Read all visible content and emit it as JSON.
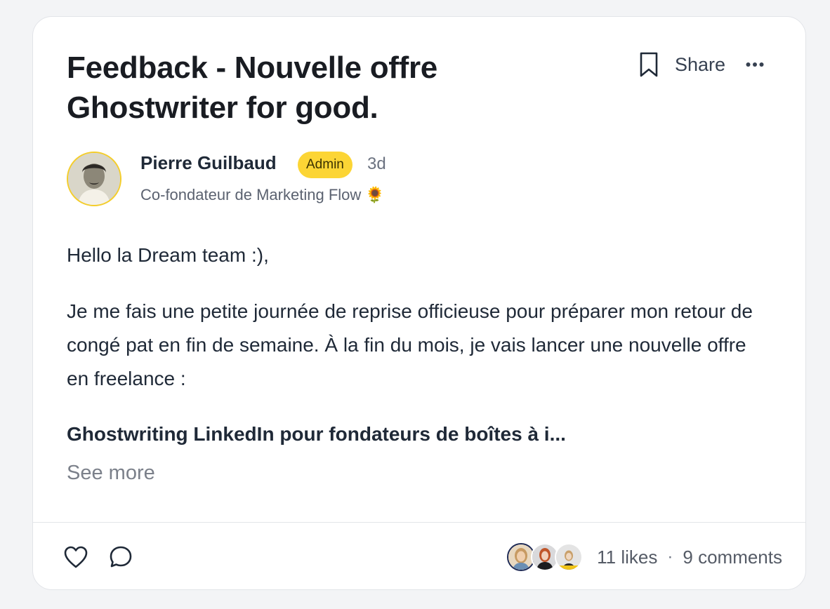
{
  "post": {
    "title": "Feedback - Nouvelle offre Ghostwriter for good.",
    "actions": {
      "share_label": "Share"
    },
    "author": {
      "name": "Pierre Guilbaud",
      "badge": "Admin",
      "time": "3d",
      "subtitle": "Co-fondateur de Marketing Flow 🌻"
    },
    "body": {
      "greeting": "Hello la Dream team :),",
      "paragraph": "Je me fais une petite journée de reprise officieuse pour préparer mon retour de congé pat en fin de semaine. À la fin du mois, je vais lancer une nouvelle offre en freelance :",
      "highlight": "Ghostwriting LinkedIn pour fondateurs de boîtes à i..."
    },
    "see_more_label": "See more",
    "footer": {
      "likes_label": "11 likes",
      "separator": "·",
      "comments_label": "9 comments"
    },
    "colors": {
      "badge_bg": "#fcd535",
      "avatar_ring": "#f4cd2a",
      "divider": "#e3e5e8"
    },
    "icons": [
      "bookmark-icon",
      "more-icon",
      "heart-icon",
      "comment-icon"
    ]
  }
}
